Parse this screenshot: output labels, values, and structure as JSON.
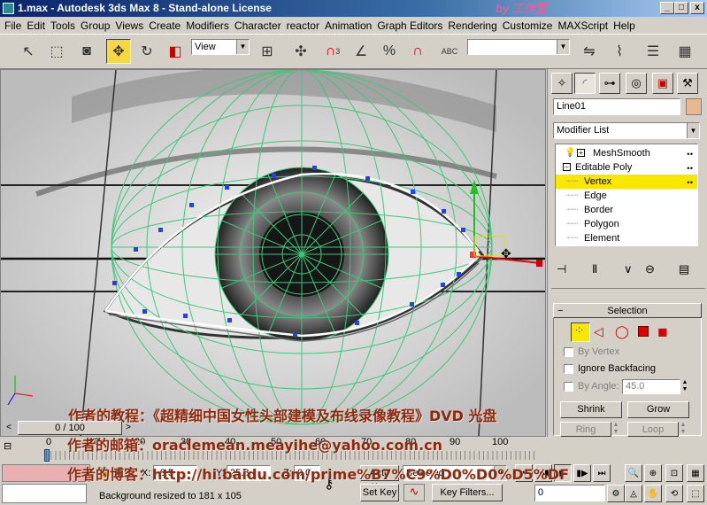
{
  "window": {
    "title": "1.max - Autodesk 3ds Max 8 - Stand-alone License",
    "corner_logo": "by 工作室",
    "buttons": [
      "_",
      "□",
      "x"
    ]
  },
  "menu": [
    "File",
    "Edit",
    "Tools",
    "Group",
    "Views",
    "Create",
    "Modifiers",
    "Character",
    "reactor",
    "Animation",
    "Graph Editors",
    "Rendering",
    "Customize",
    "MAXScript",
    "Help"
  ],
  "toolbar": {
    "view_dropdown": "View",
    "selection_set": "",
    "snap_label": "3",
    "abc_label": "ABC"
  },
  "panel": {
    "object_name": "Line01",
    "object_color": "#e8b890",
    "modifier_list": "Modifier List",
    "stack": [
      {
        "label": "MeshSmooth",
        "level": 0,
        "expander": "+"
      },
      {
        "label": "Editable Poly",
        "level": 0,
        "expander": "−"
      },
      {
        "label": "Vertex",
        "level": 1,
        "selected": true
      },
      {
        "label": "Edge",
        "level": 1
      },
      {
        "label": "Border",
        "level": 1
      },
      {
        "label": "Polygon",
        "level": 1
      },
      {
        "label": "Element",
        "level": 1
      }
    ],
    "selection": {
      "header": "Selection",
      "by_vertex": "By Vertex",
      "ignore_backfacing": "Ignore Backfacing",
      "by_angle": "By Angle:",
      "angle_value": "45.0",
      "shrink": "Shrink",
      "grow": "Grow",
      "ring": "Ring",
      "loop": "Loop",
      "status": "3 Vertices Selected"
    }
  },
  "watermark": {
    "line1": "作者的教程：《超精细中国女性头部建模及布线录像教程》DVD 光盘",
    "line2": "作者的邮箱：oraclemean.meayihe@yahoo.com.cn",
    "line3": "作者的博客：http://hi.baidu.com/prime%B7%C9%D0%D0%D5%DF"
  },
  "timeline": {
    "frame": "0 / 100",
    "ticks": [
      "0",
      "10",
      "20",
      "30",
      "40",
      "50",
      "60",
      "70",
      "80",
      "90",
      "100"
    ]
  },
  "status": {
    "x_label": "X:",
    "x_value": "-6.5",
    "y_label": "Y:",
    "y_value": "25.8",
    "z_label": "Z:",
    "z_value": "0.0",
    "auto_key": "Auto Key",
    "selected": "Selected",
    "set_key": "Set Key",
    "key_filters": "Key Filters...",
    "prompt": "Background resized to 181 x 105",
    "current_frame": "0"
  },
  "colors": {
    "selected_row": "#f8e800",
    "wire": "#3ec878",
    "vertex": "#2040ff",
    "title_start": "#0a246a"
  }
}
